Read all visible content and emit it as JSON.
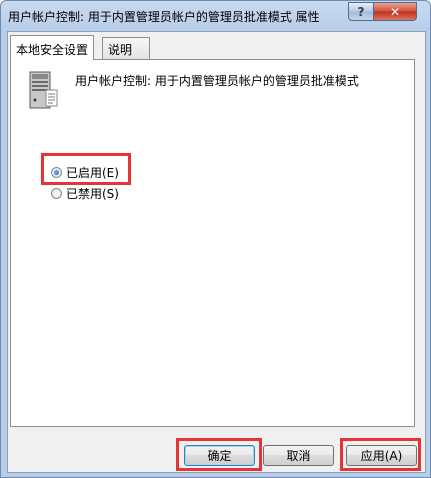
{
  "window": {
    "title": "用户帐户控制: 用于内置管理员帐户的管理员批准模式 属性",
    "help_label": "?",
    "close_label": "✕"
  },
  "tabs": [
    {
      "label": "本地安全设置",
      "active": true
    },
    {
      "label": "说明",
      "active": false
    }
  ],
  "policy": {
    "icon": "server-policy-icon",
    "name": "用户帐户控制: 用于内置管理员帐户的管理员批准模式"
  },
  "options": [
    {
      "label": "已启用(E)",
      "checked": true
    },
    {
      "label": "已禁用(S)",
      "checked": false
    }
  ],
  "buttons": {
    "ok": "确定",
    "cancel": "取消",
    "apply": "应用(A)"
  },
  "colors": {
    "highlight": "#e53436",
    "frame": "#b8cde8"
  }
}
